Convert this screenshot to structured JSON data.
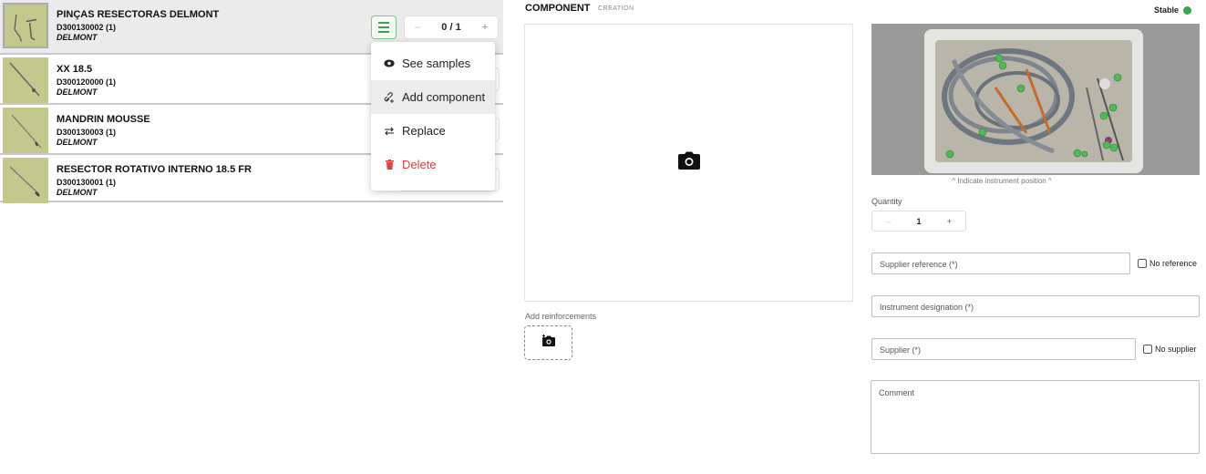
{
  "list": {
    "items": [
      {
        "name": "PINÇAS RESECTORAS DELMONT",
        "ref": "D300130002 (1)",
        "supplier": "DELMONT"
      },
      {
        "name": "XX 18.5",
        "ref": "D300120000 (1)",
        "supplier": "DELMONT"
      },
      {
        "name": "MANDRIN MOUSSE",
        "ref": "D300130003 (1)",
        "supplier": "DELMONT"
      },
      {
        "name": "RESECTOR ROTATIVO INTERNO 18.5 FR",
        "ref": "D300130001 (1)",
        "supplier": "DELMONT"
      }
    ],
    "active_stepper": {
      "minus": "–",
      "value": "0 / 1",
      "plus": "+"
    }
  },
  "menu": {
    "items": [
      {
        "label": "See samples",
        "icon": "eye-icon"
      },
      {
        "label": "Add component",
        "icon": "link-plus-icon"
      },
      {
        "label": "Replace",
        "icon": "swap-arrows-icon"
      },
      {
        "label": "Delete",
        "icon": "trash-icon"
      }
    ],
    "colors": {
      "danger": "#e0413d",
      "accent": "#3fa14f"
    }
  },
  "component": {
    "title": "COMPONENT",
    "subtitle": "CREATION",
    "add_reinforcements_label": "Add reinforcements"
  },
  "status": {
    "label": "Stable",
    "color": "#36a852"
  },
  "right": {
    "indicate_label": "^ Indicate instrument position ^",
    "quantity_label": "Quantity",
    "quantity": {
      "minus": "–",
      "value": "1",
      "plus": "+"
    },
    "supplier_reference_placeholder": "Supplier reference (*)",
    "no_reference_label": "No reference",
    "instrument_designation_placeholder": "Instrument designation (*)",
    "supplier_placeholder": "Supplier (*)",
    "no_supplier_label": "No supplier",
    "comment_placeholder": "Comment"
  }
}
